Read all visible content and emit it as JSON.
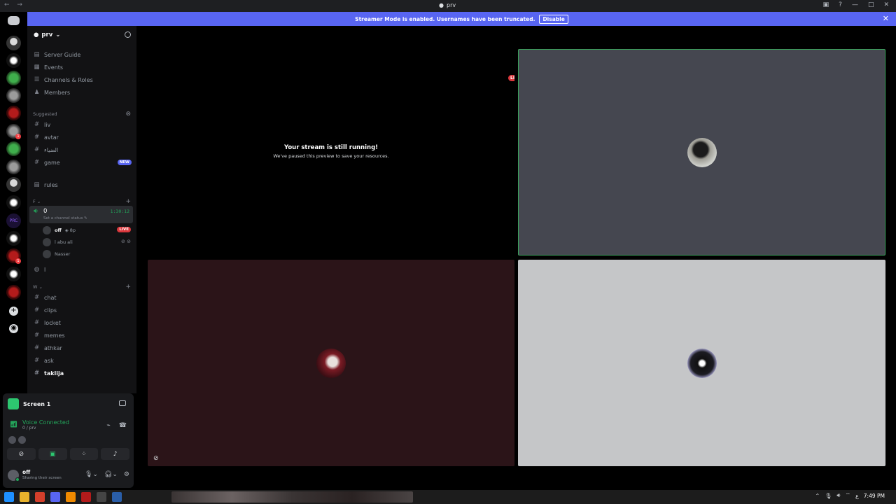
{
  "window": {
    "title": "prv",
    "nav": "← →"
  },
  "streamer": {
    "message": "Streamer Mode is enabled. Usernames have been truncated.",
    "button": "Disable"
  },
  "server": {
    "name": "prv"
  },
  "menu": [
    {
      "label": "Server Guide",
      "icon": "guide-icon"
    },
    {
      "label": "Events",
      "icon": "calendar-icon"
    },
    {
      "label": "Channels & Roles",
      "icon": "channels-icon"
    },
    {
      "label": "Members",
      "icon": "members-icon"
    }
  ],
  "suggested": {
    "label": "Suggested",
    "channels": [
      "liv",
      "avtar",
      "الضياء",
      "game"
    ],
    "new_badge": "NEW"
  },
  "rules": "rules",
  "cat_f": {
    "label": "F"
  },
  "voice": {
    "name": "0",
    "time": "1:30:12",
    "status": "Set a channel status",
    "users": [
      {
        "name": "off",
        "extra": "◈ 8p",
        "live": "LIVE"
      },
      {
        "name": "l abu ali"
      },
      {
        "name": "Nasser"
      }
    ]
  },
  "voice2": {
    "name": "l"
  },
  "cat_w": {
    "label": "W"
  },
  "text_channels": [
    "chat",
    "clips",
    "locket",
    "memes",
    "athkar",
    "ask",
    "taklija"
  ],
  "panel": {
    "screen_label": "Screen 1",
    "voice_connected": "Voice Connected",
    "voice_channel": "0 / prv",
    "user_name": "off",
    "user_status": "Sharing their screen"
  },
  "stage": {
    "live": "LIVE",
    "paused_title": "Your stream is still running!",
    "paused_sub": "We've paused this preview to save your resources."
  },
  "clock": "7:49 PM",
  "tray_lang": "ع"
}
